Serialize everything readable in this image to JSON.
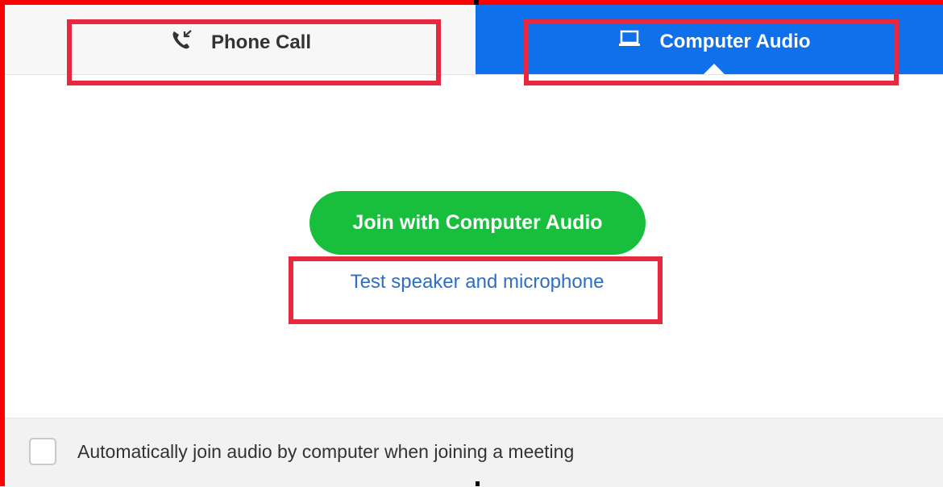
{
  "tabs": {
    "phone_call": {
      "label": "Phone Call",
      "icon": "phone-call-icon"
    },
    "computer_audio": {
      "label": "Computer Audio",
      "icon": "laptop-icon",
      "active": true
    }
  },
  "main": {
    "join_button_label": "Join with Computer Audio",
    "test_link_label": "Test speaker and microphone"
  },
  "footer": {
    "auto_join_label": "Automatically join audio by computer when joining a meeting",
    "auto_join_checked": false
  },
  "colors": {
    "active_tab": "#0e71eb",
    "join_button": "#18bf3d",
    "link": "#2d6fc4",
    "highlight": "#e8283e",
    "frame": "#ff0000"
  }
}
